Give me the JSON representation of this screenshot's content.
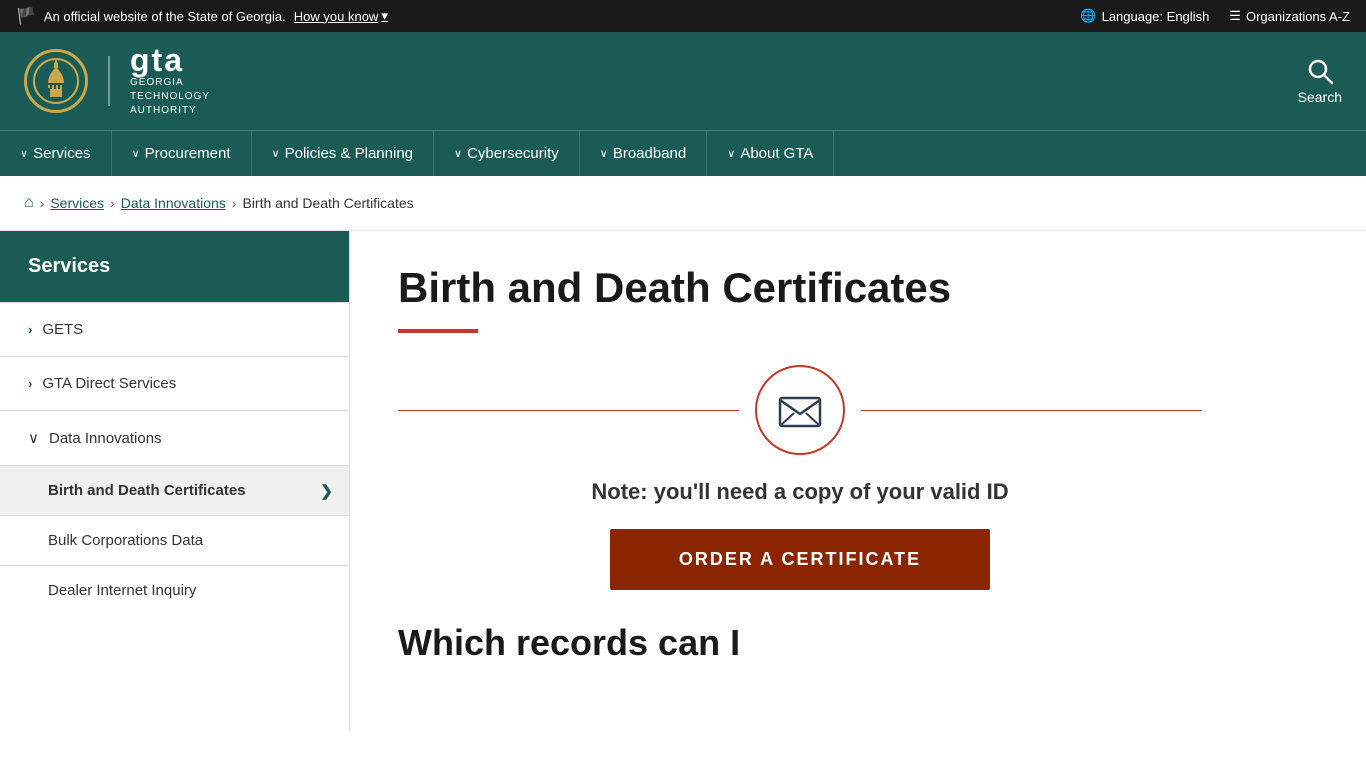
{
  "topbar": {
    "official_text": "An official website of the State of Georgia.",
    "how_you_know": "How you know",
    "language_label": "Language: English",
    "orgs_label": "Organizations A-Z"
  },
  "header": {
    "gta_big": "gta",
    "gta_sub": "GEORGIA\nTECHNOLOGY\nAUTHORITY",
    "search_label": "Search"
  },
  "nav": {
    "items": [
      {
        "label": "Services",
        "id": "services"
      },
      {
        "label": "Procurement",
        "id": "procurement"
      },
      {
        "label": "Policies & Planning",
        "id": "policies"
      },
      {
        "label": "Cybersecurity",
        "id": "cybersecurity"
      },
      {
        "label": "Broadband",
        "id": "broadband"
      },
      {
        "label": "About GTA",
        "id": "about"
      }
    ]
  },
  "breadcrumb": {
    "home_label": "Home",
    "services_label": "Services",
    "data_innovations_label": "Data Innovations",
    "current_label": "Birth and Death Certificates"
  },
  "sidebar": {
    "header_label": "Services",
    "items": [
      {
        "label": "GETS",
        "id": "gets",
        "type": "expandable"
      },
      {
        "label": "GTA Direct Services",
        "id": "gta-direct",
        "type": "expandable"
      },
      {
        "label": "Data Innovations",
        "id": "data-innovations",
        "type": "expanded"
      }
    ],
    "sub_items": [
      {
        "label": "Birth and Death Certificates",
        "id": "birth-death",
        "active": true
      },
      {
        "label": "Bulk Corporations Data",
        "id": "bulk-corps"
      },
      {
        "label": "Dealer Internet Inquiry",
        "id": "dealer"
      }
    ]
  },
  "content": {
    "page_title": "Birth and Death Certificates",
    "note_text": "Note: you'll need a copy of your valid ID",
    "order_button_label": "ORDER A CERTIFICATE",
    "which_records_label": "Which records can I"
  }
}
